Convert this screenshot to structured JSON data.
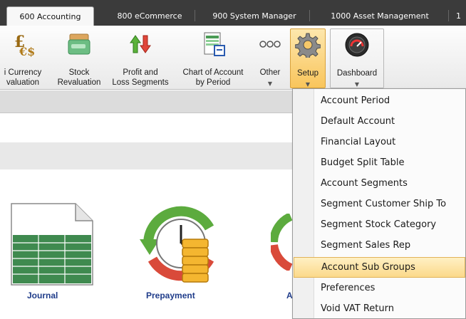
{
  "tabs": [
    "600 Accounting",
    "800 eCommerce",
    "900 System Manager",
    "1000 Asset Management",
    "1"
  ],
  "ribbon": {
    "currency_revaluation": [
      "i Currency",
      "valuation"
    ],
    "stock_revaluation": [
      "Stock",
      "Revaluation"
    ],
    "profit_loss_segments": [
      "Profit and",
      "Loss Segments"
    ],
    "chart_of_account_by_period": [
      "Chart of Account",
      "by Period"
    ],
    "other": "Other",
    "setup": "Setup",
    "dashboard": "Dashboard",
    "dropdown_arrow": "▼"
  },
  "tiles": [
    "Journal",
    "Prepayment",
    "A"
  ],
  "setup_menu": [
    "Account Period",
    "Default Account",
    "Financial Layout",
    "Budget Split Table",
    "Account Segments",
    "Segment Customer Ship To",
    "Segment Stock Category",
    "Segment Sales Rep",
    "Account Sub Groups",
    "Preferences",
    "Void VAT Return"
  ],
  "highlighted_menu_item": "Account Sub Groups",
  "colors": {
    "tab_bar": "#3b3b3b",
    "highlight": "#fbd98a",
    "tile_label": "#1f3c8a"
  }
}
